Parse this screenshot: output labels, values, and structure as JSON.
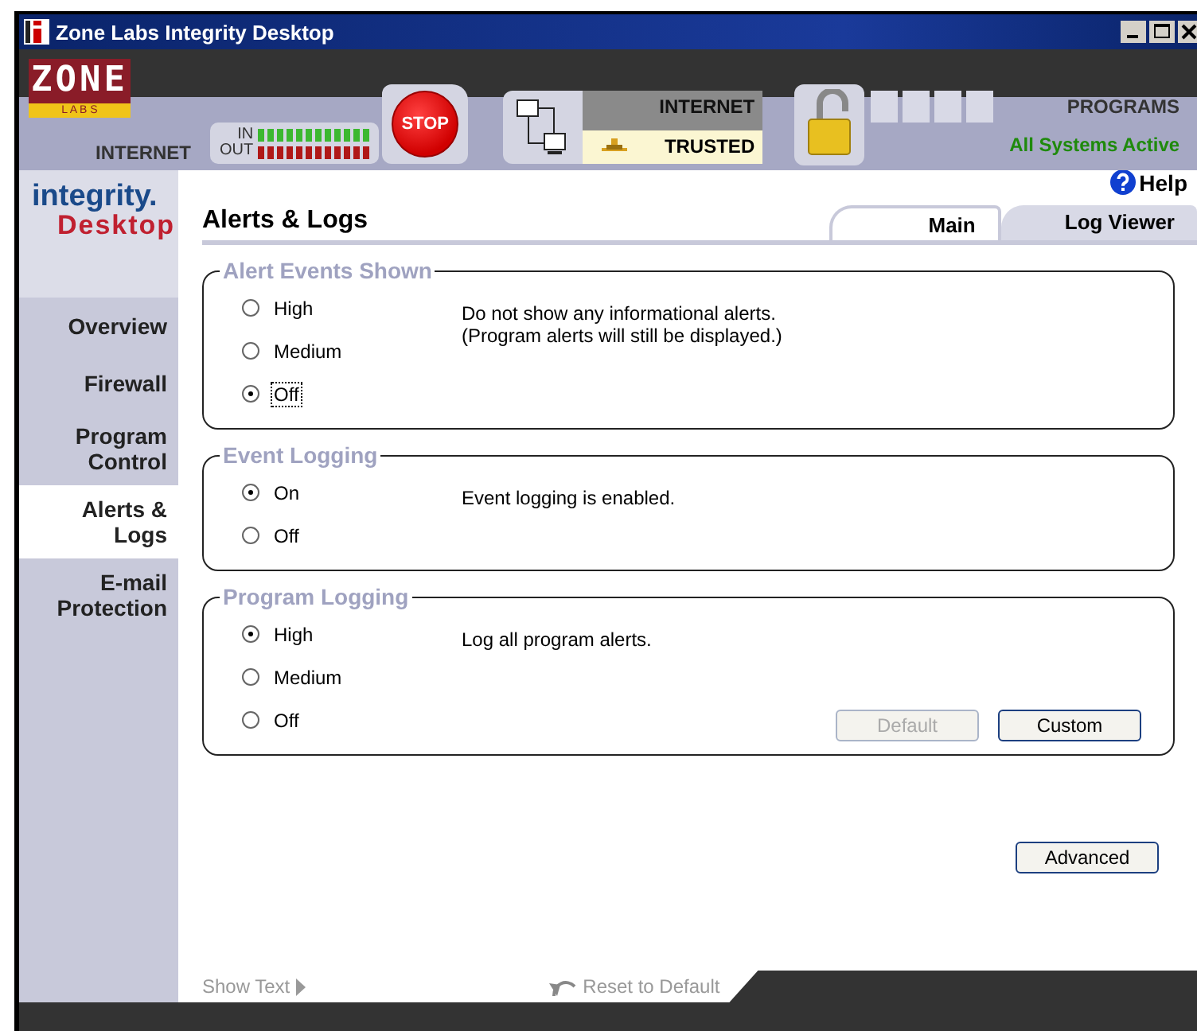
{
  "window": {
    "title": "Zone Labs Integrity Desktop"
  },
  "header": {
    "logo_top": "ZONE",
    "logo_bottom": "L A B S",
    "zone_label": "INTERNET",
    "traffic": {
      "in_label": "IN",
      "out_label": "OUT"
    },
    "stop_button": "STOP",
    "network": {
      "zone_1": "INTERNET",
      "zone_2": "TRUSTED"
    },
    "programs_label": "PROGRAMS",
    "status": "All Systems Active"
  },
  "sidebar": {
    "logo": {
      "line_1": "integrity.",
      "line_2": "Desktop"
    },
    "items": [
      {
        "label": "Overview",
        "selected": false
      },
      {
        "label": "Firewall",
        "selected": false
      },
      {
        "label": "Program Control",
        "selected": false
      },
      {
        "label": "Alerts & Logs",
        "selected": true
      },
      {
        "label": "E-mail Protection",
        "selected": false
      }
    ]
  },
  "page": {
    "title": "Alerts & Logs",
    "help": "Help",
    "tabs": [
      {
        "label": "Main",
        "selected": true
      },
      {
        "label": "Log Viewer",
        "selected": false
      }
    ],
    "groups": [
      {
        "title": "Alert Events Shown",
        "options": [
          {
            "label": "High",
            "selected": false,
            "focused": false
          },
          {
            "label": "Medium",
            "selected": false,
            "focused": false
          },
          {
            "label": "Off",
            "selected": true,
            "focused": true
          }
        ],
        "description": [
          "Do not show any informational alerts.",
          "(Program alerts will still be displayed.)"
        ]
      },
      {
        "title": "Event Logging",
        "options": [
          {
            "label": "On",
            "selected": true,
            "focused": false
          },
          {
            "label": "Off",
            "selected": false,
            "focused": false
          }
        ],
        "description": [
          "Event logging is enabled."
        ]
      },
      {
        "title": "Program Logging",
        "options": [
          {
            "label": "High",
            "selected": true,
            "focused": false
          },
          {
            "label": "Medium",
            "selected": false,
            "focused": false
          },
          {
            "label": "Off",
            "selected": false,
            "focused": false
          }
        ],
        "description": [
          "Log all program alerts."
        ],
        "buttons": [
          {
            "label": "Default",
            "disabled": true
          },
          {
            "label": "Custom",
            "disabled": false
          }
        ]
      }
    ],
    "advanced_button": "Advanced"
  },
  "footer": {
    "show_text": "Show Text",
    "reset": "Reset to Default"
  }
}
